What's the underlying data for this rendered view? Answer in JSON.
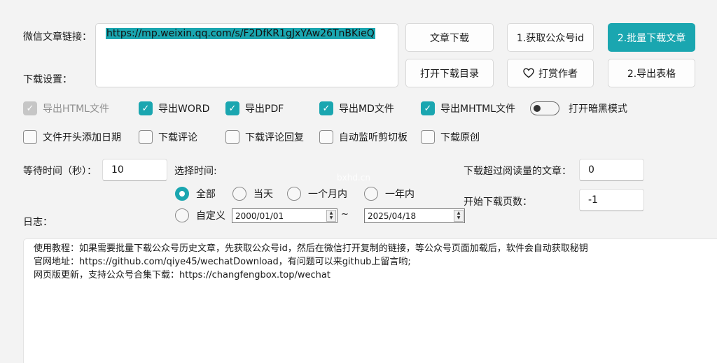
{
  "labels": {
    "url": "微信文章链接：",
    "download_settings": "下载设置：",
    "wait_time": "等待时间（秒）：",
    "select_time": "选择时间:",
    "read_threshold": "下载超过阅读量的文章：",
    "start_page": "开始下载页数：",
    "log": "日志："
  },
  "url_value": "https://mp.weixin.qq.com/s/F2DfKR1gJxYAw26TnBKieQ",
  "buttons": {
    "download_article": "文章下载",
    "get_account_id": "1.获取公众号id",
    "batch_download": "2.批量下载文章",
    "open_download_dir": "打开下载目录",
    "tip_author": "打赏作者",
    "export_table": "2.导出表格"
  },
  "checkboxes_row1": [
    {
      "label": "导出HTML文件",
      "state": "disabled-checked"
    },
    {
      "label": "导出WORD",
      "state": "checked"
    },
    {
      "label": "导出PDF",
      "state": "checked"
    },
    {
      "label": "导出MD文件",
      "state": "checked"
    },
    {
      "label": "导出MHTML文件",
      "state": "checked"
    }
  ],
  "dark_mode_label": "打开暗黑模式",
  "checkboxes_row2": [
    {
      "label": "文件开头添加日期",
      "state": "unchecked"
    },
    {
      "label": "下载评论",
      "state": "unchecked"
    },
    {
      "label": "下载评论回复",
      "state": "unchecked"
    },
    {
      "label": "自动监听剪切板",
      "state": "unchecked"
    },
    {
      "label": "下载原创",
      "state": "unchecked"
    }
  ],
  "wait_time_value": "10",
  "read_threshold_value": "0",
  "start_page_value": "-1",
  "time_options": [
    "全部",
    "当天",
    "一个月内",
    "一年内",
    "自定义"
  ],
  "selected_time_option": "全部",
  "date_from": "2000/01/01",
  "date_sep": "~",
  "date_to": "2025/04/18",
  "log_lines": [
    "使用教程：如果需要批量下载公众号历史文章，先获取公众号id，然后在微信打开复制的链接，等公众号页面加载后，软件会自动获取秘钥",
    "官网地址：https://github.com/qiye45/wechatDownload，有问题可以来github上留言哟;",
    "网页版更新，支持公众号合集下载：https://changfengbox.top/wechat"
  ],
  "watermark": "bxhd.cn",
  "accent_color": "#1aa6b0",
  "icons": {
    "tip_author": "heart-icon",
    "checkmark": "check-icon"
  }
}
